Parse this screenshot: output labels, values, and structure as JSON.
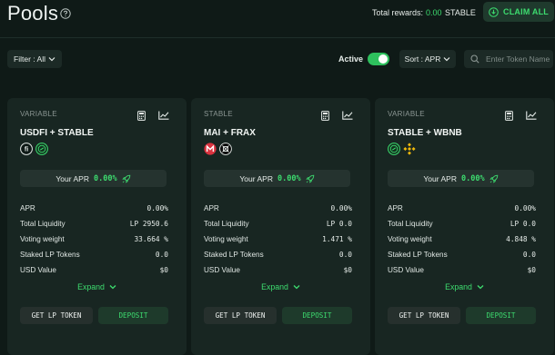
{
  "header": {
    "title": "Pools",
    "total_rewards_label": "Total rewards:",
    "total_rewards_value": "0.00",
    "total_rewards_unit": "STABLE",
    "claim_label": "CLAIM ALL"
  },
  "toolbar": {
    "filter_label": "Filter : All",
    "active_label": "Active",
    "active_on": true,
    "sort_label": "Sort : APR",
    "search_placeholder": "Enter Token Name"
  },
  "colors": {
    "accent": "#3ddc6f",
    "background": "#0f1a17",
    "card": "#182622"
  },
  "pools": [
    {
      "type": "VARIABLE",
      "pair": "USDFI + STABLE",
      "token_icons": [
        "usdfi-icon",
        "stable-icon"
      ],
      "your_apr_label": "Your APR",
      "your_apr_value": "0.00%",
      "stats": [
        {
          "label": "APR",
          "value": "0.00%"
        },
        {
          "label": "Total Liquidity",
          "value": "LP 2950.6"
        },
        {
          "label": "Voting weight",
          "value": "33.664 %"
        },
        {
          "label": "Staked LP Tokens",
          "value": "0.0"
        },
        {
          "label": "USD Value",
          "value": "$0"
        }
      ],
      "expand_label": "Expand",
      "get_lp_label": "GET LP TOKEN",
      "deposit_label": "DEPOSIT"
    },
    {
      "type": "STABLE",
      "pair": "MAI + FRAX",
      "token_icons": [
        "mai-icon",
        "frax-icon"
      ],
      "your_apr_label": "Your APR",
      "your_apr_value": "0.00%",
      "stats": [
        {
          "label": "APR",
          "value": "0.00%"
        },
        {
          "label": "Total Liquidity",
          "value": "LP 0.0"
        },
        {
          "label": "Voting weight",
          "value": "1.471 %"
        },
        {
          "label": "Staked LP Tokens",
          "value": "0.0"
        },
        {
          "label": "USD Value",
          "value": "$0"
        }
      ],
      "expand_label": "Expand",
      "get_lp_label": "GET LP TOKEN",
      "deposit_label": "DEPOSIT"
    },
    {
      "type": "VARIABLE",
      "pair": "STABLE + WBNB",
      "token_icons": [
        "stable-icon",
        "wbnb-icon"
      ],
      "your_apr_label": "Your APR",
      "your_apr_value": "0.00%",
      "stats": [
        {
          "label": "APR",
          "value": "0.00%"
        },
        {
          "label": "Total Liquidity",
          "value": "LP 0.0"
        },
        {
          "label": "Voting weight",
          "value": "4.848 %"
        },
        {
          "label": "Staked LP Tokens",
          "value": "0.0"
        },
        {
          "label": "USD Value",
          "value": "$0"
        }
      ],
      "expand_label": "Expand",
      "get_lp_label": "GET LP TOKEN",
      "deposit_label": "DEPOSIT"
    }
  ]
}
